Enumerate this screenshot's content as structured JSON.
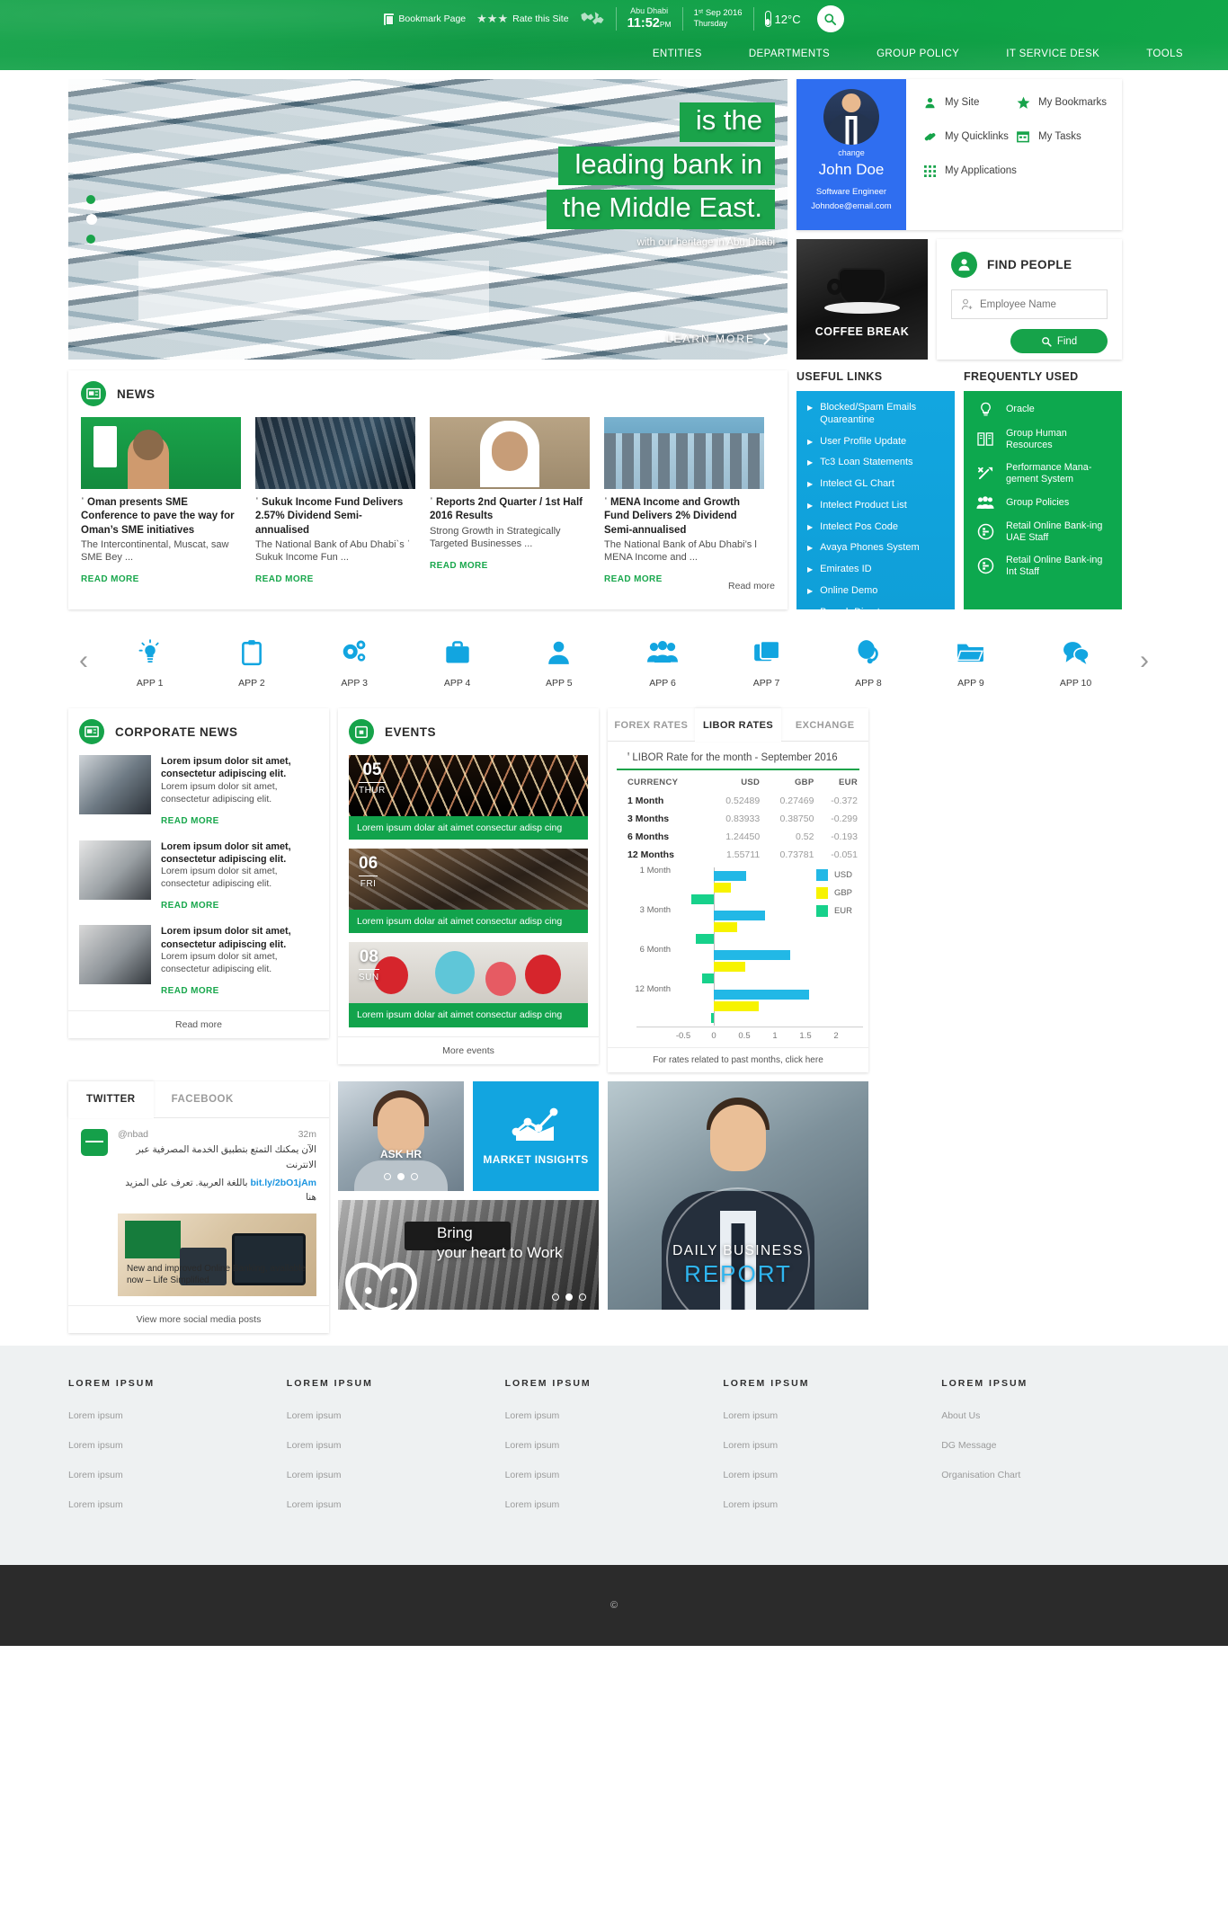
{
  "topbar": {
    "bookmark": "Bookmark Page",
    "rate": "Rate this Site",
    "stars": "★★★",
    "city": "Abu Dhabi",
    "time": "11:52",
    "ampm": "PM",
    "date": "1ˢᵗ Sep 2016",
    "weekday": "Thursday",
    "temp": "12°C",
    "nav": [
      {
        "label": "ENTITIES"
      },
      {
        "label": "DEPARTMENTS"
      },
      {
        "label": "GROUP POLICY"
      },
      {
        "label": "IT SERVICE DESK"
      },
      {
        "label": "TOOLS"
      }
    ]
  },
  "hero": {
    "line1": "is the",
    "line2": "leading bank in",
    "line3": "the Middle East.",
    "subtitle": "with our heritage in Abu Dhabi",
    "cta": "LEARN MORE"
  },
  "profile": {
    "change": "change",
    "name": "John Doe",
    "role": "Software Engineer",
    "email": "Johndoe@email.com",
    "links": [
      {
        "label": "My Site",
        "icon": "person-icon"
      },
      {
        "label": "My Bookmarks",
        "icon": "star-icon"
      },
      {
        "label": "My Quicklinks",
        "icon": "link-icon"
      },
      {
        "label": "My Tasks",
        "icon": "calendar-icon"
      },
      {
        "label": "My Applications",
        "icon": "grid-icon"
      }
    ]
  },
  "coffee": {
    "label": "COFFEE BREAK"
  },
  "find_people": {
    "title": "FIND PEOPLE",
    "placeholder": "Employee Name",
    "value": "",
    "button": "Find"
  },
  "news": {
    "title": "NEWS",
    "read_more_label": "READ MORE",
    "footer": "Read more",
    "items": [
      {
        "title": "ˈ Oman presents SME Conference to pave the way for Oman’s SME initiatives",
        "desc": "The Intercontinental, Muscat, saw SME Bey ..."
      },
      {
        "title": "ˈ Sukuk Income Fund Delivers 2.57% Dividend Semi-annualised",
        "desc": "The National Bank of Abu Dhabi`s        ˈ Sukuk Income Fun ..."
      },
      {
        "title": "ˈ Reports 2nd Quarter / 1st Half 2016 Results",
        "desc": "Strong Growth in Strategically Targeted Businesses ..."
      },
      {
        "title": "ˈ MENA Income and Growth Fund Delivers 2% Dividend Semi-annualised",
        "desc": "The National Bank of Abu Dhabi’s l         MENA Income and ..."
      }
    ]
  },
  "useful_links": {
    "title": "USEFUL LINKS",
    "items": [
      {
        "label": "Blocked/Spam Emails Quareantine"
      },
      {
        "label": "User Profile Update"
      },
      {
        "label": "Tc3 Loan Statements"
      },
      {
        "label": "Intelect GL Chart"
      },
      {
        "label": "Intelect Product List"
      },
      {
        "label": "Intelect Pos Code"
      },
      {
        "label": "Avaya Phones System"
      },
      {
        "label": "Emirates ID"
      },
      {
        "label": "        Online Demo"
      },
      {
        "label": "Branch Directory"
      }
    ]
  },
  "frequently_used": {
    "title": "FREQUENTLY USED",
    "items": [
      {
        "label": "Oracle",
        "icon": "bulb-icon"
      },
      {
        "label": "Group Human Resources",
        "icon": "books-icon"
      },
      {
        "label": "Performance Mana-gement System",
        "icon": "wrench-icon"
      },
      {
        "label": "Group Policies",
        "icon": "people-icon"
      },
      {
        "label": "Retail Online Bank-ing UAE Staff",
        "icon": "coin-icon"
      },
      {
        "label": "Retail Online Bank-ing Int Staff",
        "icon": "coin-icon"
      }
    ]
  },
  "apps": {
    "prev": "‹",
    "next": "›",
    "items": [
      {
        "label": "APP 1",
        "icon": "bulb-icon"
      },
      {
        "label": "APP 2",
        "icon": "clipboard-icon"
      },
      {
        "label": "APP 3",
        "icon": "gears-icon"
      },
      {
        "label": "APP 4",
        "icon": "briefcase-icon"
      },
      {
        "label": "APP 5",
        "icon": "person-icon"
      },
      {
        "label": "APP 6",
        "icon": "people-icon"
      },
      {
        "label": "APP 7",
        "icon": "windows-icon"
      },
      {
        "label": "APP 8",
        "icon": "headset-icon"
      },
      {
        "label": "APP 9",
        "icon": "folder-icon"
      },
      {
        "label": "APP 10",
        "icon": "chat-icon"
      }
    ]
  },
  "corporate_news": {
    "title": "CORPORATE NEWS",
    "read_more_label": "READ MORE",
    "footer": "Read more",
    "items": [
      {
        "bold": "Lorem ipsum dolor sit amet, consectetur adipiscing elit.",
        "normal": "Lorem ipsum dolor sit amet, consectetur adipiscing elit."
      },
      {
        "bold": "Lorem ipsum dolor sit amet, consectetur adipiscing elit.",
        "normal": "Lorem ipsum dolor sit amet, consectetur adipiscing elit."
      },
      {
        "bold": "Lorem ipsum dolor sit amet, consectetur adipiscing elit.",
        "normal": "Lorem ipsum dolor sit amet, consectetur adipiscing elit."
      }
    ]
  },
  "events": {
    "title": "EVENTS",
    "footer": "More events",
    "items": [
      {
        "day": "05",
        "weekday": "THUR",
        "caption": "Lorem ipsum dolar ait aimet consectur adisp cing"
      },
      {
        "day": "06",
        "weekday": "FRI",
        "caption": "Lorem ipsum dolar ait aimet consectur adisp cing"
      },
      {
        "day": "08",
        "weekday": "SUN",
        "caption": "Lorem ipsum dolar ait aimet consectur adisp cing"
      }
    ]
  },
  "rates": {
    "tabs": [
      {
        "label": "FOREX RATES",
        "active": false
      },
      {
        "label": "LIBOR RATES",
        "active": true
      },
      {
        "label": "EXCHANGE",
        "active": false
      }
    ],
    "subtitle": "ꞌ LIBOR Rate for the month - September 2016",
    "footer": "For rates related to past months, click here",
    "columns": [
      "CURRENCY",
      "USD",
      "GBP",
      "EUR"
    ],
    "rows": [
      [
        "1 Month",
        "0.52489",
        "0.27469",
        "-0.372"
      ],
      [
        "3 Months",
        "0.83933",
        "0.38750",
        "-0.299"
      ],
      [
        "6 Months",
        "1.24450",
        "0.52",
        "-0.193"
      ],
      [
        "12 Months",
        "1.55711",
        "0.73781",
        "-0.051"
      ]
    ]
  },
  "chart_data": {
    "type": "bar",
    "title": "LIBOR Rate for the month - September 2016",
    "orientation": "horizontal",
    "categories": [
      "1 Month",
      "3 Month",
      "6 Month",
      "12 Month"
    ],
    "series": [
      {
        "name": "USD",
        "color": "#22b8e6",
        "values": [
          0.52489,
          0.83933,
          1.2445,
          1.55711
        ]
      },
      {
        "name": "GBP",
        "color": "#f7f300",
        "values": [
          0.27469,
          0.3875,
          0.52,
          0.73781
        ]
      },
      {
        "name": "EUR",
        "color": "#17d18b",
        "values": [
          -0.372,
          -0.299,
          -0.193,
          -0.051
        ]
      }
    ],
    "xlabel": "",
    "ylabel": "",
    "xlim": [
      -0.75,
      2.0
    ],
    "xticks": [
      -0.5,
      0,
      0.5,
      1,
      1.5,
      2
    ],
    "xtick_labels": [
      "-0.5",
      "0",
      "0.5",
      "1",
      "1.5",
      "2"
    ],
    "grid": false,
    "legend_position": "top-right"
  },
  "social": {
    "tabs": [
      {
        "label": "TWITTER",
        "active": true
      },
      {
        "label": "FACEBOOK",
        "active": false
      }
    ],
    "handle": "@nbad",
    "time": "32m",
    "text_line1": "الآن يمكنك التمتع بتطبيق الخدمة المصرفية عبر الانترنت",
    "text_line2_prefix": "باللغة العربية. تعرف على المزيد هنا",
    "link": "bit.ly/2bO1jAm",
    "card_caption": "New and improved Online Banking, available now – Life Simplified",
    "footer": "View more social media posts"
  },
  "promos": {
    "ask_hr": "ASK HR",
    "market_insights": "MARKET INSIGHTS",
    "bring_line1": "Bring",
    "bring_line2": "your heart to Work",
    "report_line1": "DAILY BUSINESS",
    "report_line2": "REPORT"
  },
  "footer": {
    "columns": [
      {
        "title": "LOREM IPSUM",
        "links": [
          "Lorem ipsum",
          "Lorem ipsum",
          "Lorem ipsum",
          "Lorem ipsum"
        ]
      },
      {
        "title": "LOREM IPSUM",
        "links": [
          "Lorem ipsum",
          "Lorem ipsum",
          "Lorem ipsum",
          "Lorem ipsum"
        ]
      },
      {
        "title": "LOREM IPSUM",
        "links": [
          "Lorem ipsum",
          "Lorem ipsum",
          "Lorem ipsum",
          "Lorem ipsum"
        ]
      },
      {
        "title": "LOREM IPSUM",
        "links": [
          "Lorem ipsum",
          "Lorem ipsum",
          "Lorem ipsum",
          "Lorem ipsum"
        ]
      },
      {
        "title": "LOREM IPSUM",
        "links": [
          "About Us",
          "DG Message",
          "Organisation Chart"
        ]
      }
    ],
    "copyright": "©"
  },
  "colors": {
    "green": "#16a34a",
    "blue": "#12a5e0",
    "profile_blue": "#2f6ef0",
    "usd": "#22b8e6",
    "gbp": "#f7f300",
    "eur": "#17d18b"
  }
}
